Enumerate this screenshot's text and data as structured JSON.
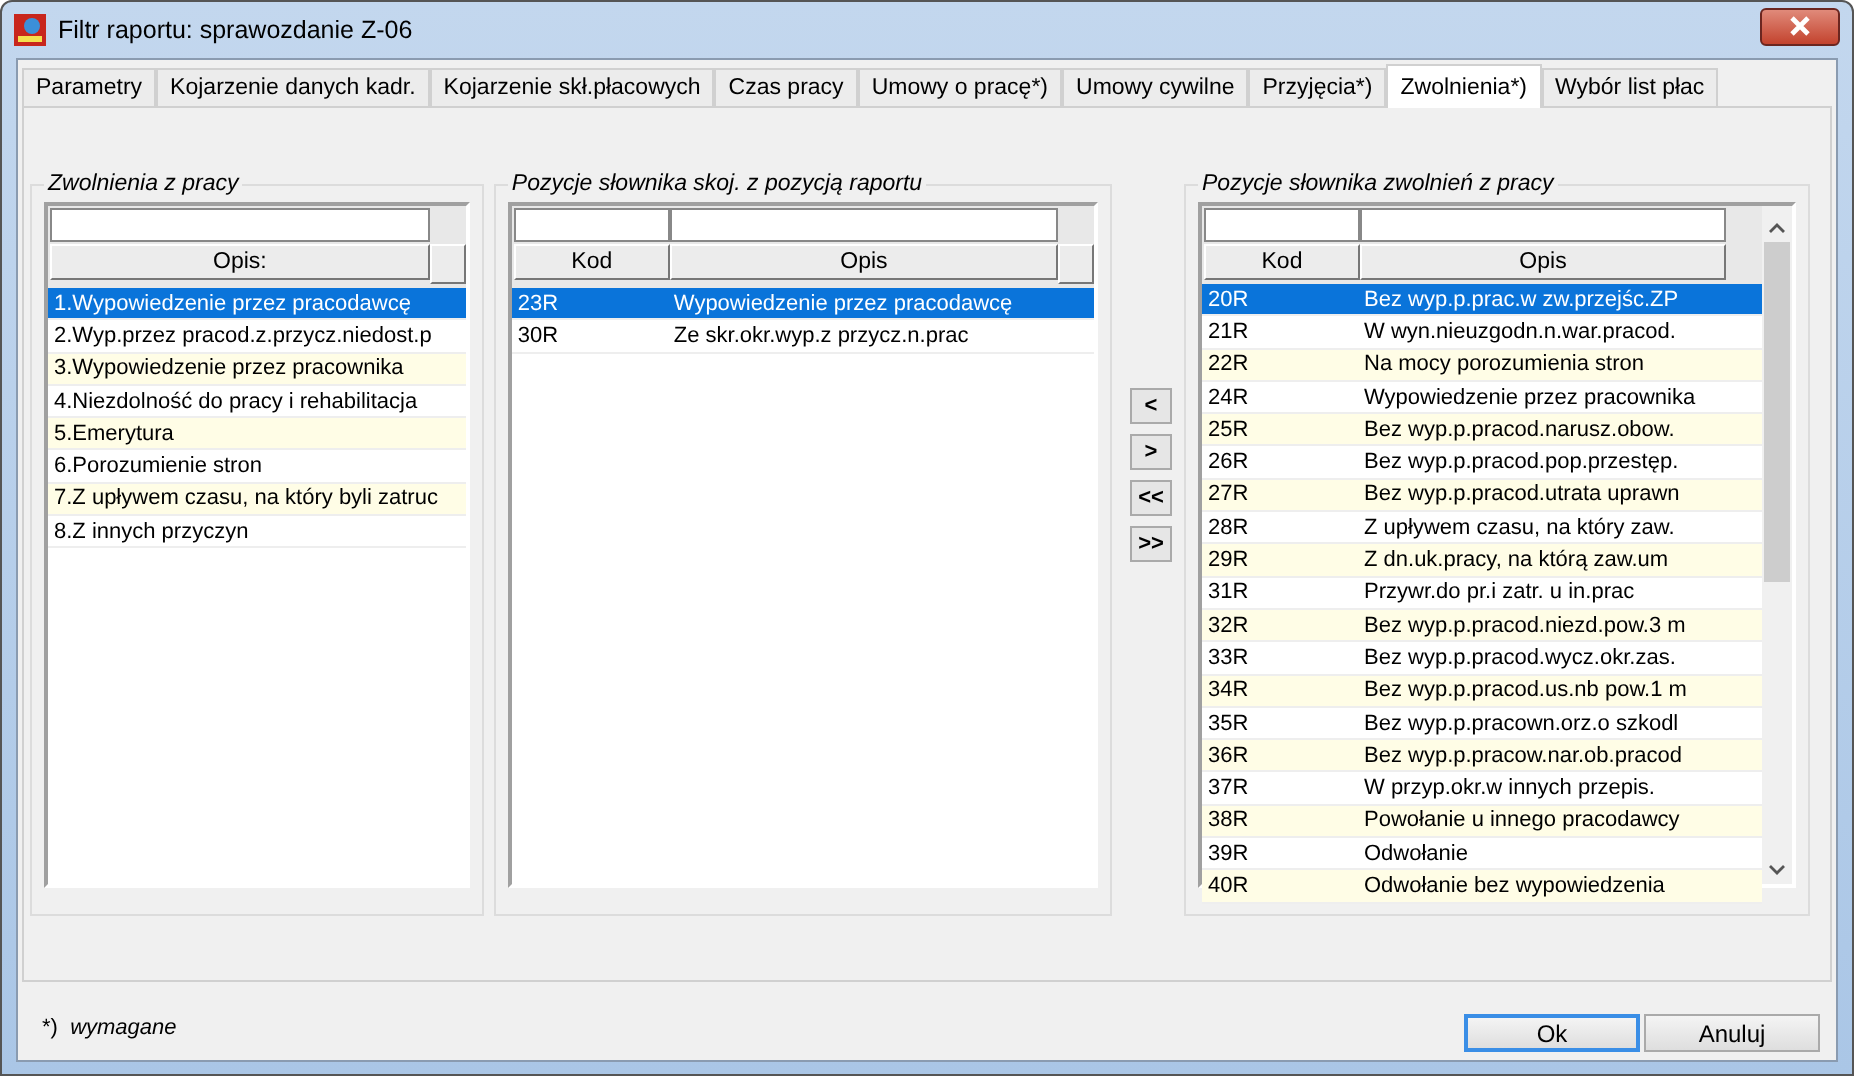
{
  "window": {
    "title": "Filtr raportu: sprawozdanie Z-06"
  },
  "tabs": [
    {
      "label": "Parametry",
      "selected": false
    },
    {
      "label": "Kojarzenie danych kadr.",
      "selected": false
    },
    {
      "label": "Kojarzenie skł.płacowych",
      "selected": false
    },
    {
      "label": "Czas pracy",
      "selected": false
    },
    {
      "label": "Umowy o pracę*)",
      "selected": false
    },
    {
      "label": "Umowy cywilne",
      "selected": false
    },
    {
      "label": "Przyjęcia*)",
      "selected": false
    },
    {
      "label": "Zwolnienia*)",
      "selected": true
    },
    {
      "label": "Wybór list płac",
      "selected": false
    }
  ],
  "groups": [
    {
      "title": "Zwolnienia z pracy",
      "scrollable": false,
      "columns": [
        "Opis:"
      ],
      "rows": [
        {
          "cells": [
            "1.Wypowiedzenie przez pracodawcę"
          ],
          "selected": true
        },
        {
          "cells": [
            "2.Wyp.przez pracod.z.przycz.niedost.p"
          ],
          "selected": false
        },
        {
          "cells": [
            "3.Wypowiedzenie przez pracownika"
          ],
          "selected": false
        },
        {
          "cells": [
            "4.Niezdolność do pracy i rehabilitacja"
          ],
          "selected": false
        },
        {
          "cells": [
            "5.Emerytura"
          ],
          "selected": false
        },
        {
          "cells": [
            "6.Porozumienie stron"
          ],
          "selected": false
        },
        {
          "cells": [
            "7.Z upływem czasu, na który byli zatruc"
          ],
          "selected": false
        },
        {
          "cells": [
            "8.Z innych przyczyn"
          ],
          "selected": false
        }
      ]
    },
    {
      "title": "Pozycje słownika skoj. z pozycją raportu",
      "scrollable": false,
      "columns": [
        "Kod",
        "Opis"
      ],
      "rows": [
        {
          "cells": [
            "23R",
            "Wypowiedzenie przez pracodawcę"
          ],
          "selected": true
        },
        {
          "cells": [
            "30R",
            "Ze skr.okr.wyp.z przycz.n.prac"
          ],
          "selected": false
        }
      ]
    },
    {
      "title": "Pozycje słownika zwolnień z pracy",
      "scrollable": true,
      "columns": [
        "Kod",
        "Opis"
      ],
      "rows": [
        {
          "cells": [
            "20R",
            "Bez wyp.p.prac.w zw.przejśc.ZP"
          ],
          "selected": true
        },
        {
          "cells": [
            "21R",
            "W wyn.nieuzgodn.n.war.pracod."
          ],
          "selected": false
        },
        {
          "cells": [
            "22R",
            "Na mocy porozumienia stron"
          ],
          "selected": false
        },
        {
          "cells": [
            "24R",
            "Wypowiedzenie przez pracownika"
          ],
          "selected": false
        },
        {
          "cells": [
            "25R",
            "Bez wyp.p.pracod.narusz.obow."
          ],
          "selected": false
        },
        {
          "cells": [
            "26R",
            "Bez wyp.p.pracod.pop.przestęp."
          ],
          "selected": false
        },
        {
          "cells": [
            "27R",
            "Bez wyp.p.pracod.utrata uprawn"
          ],
          "selected": false
        },
        {
          "cells": [
            "28R",
            "Z upływem czasu, na który zaw."
          ],
          "selected": false
        },
        {
          "cells": [
            "29R",
            "Z dn.uk.pracy, na którą zaw.um"
          ],
          "selected": false
        },
        {
          "cells": [
            "31R",
            "Przywr.do pr.i zatr. u in.prac"
          ],
          "selected": false
        },
        {
          "cells": [
            "32R",
            "Bez wyp.p.pracod.niezd.pow.3 m"
          ],
          "selected": false
        },
        {
          "cells": [
            "33R",
            "Bez wyp.p.pracod.wycz.okr.zas."
          ],
          "selected": false
        },
        {
          "cells": [
            "34R",
            "Bez wyp.p.pracod.us.nb pow.1 m"
          ],
          "selected": false
        },
        {
          "cells": [
            "35R",
            "Bez wyp.p.pracown.orz.o szkodl"
          ],
          "selected": false
        },
        {
          "cells": [
            "36R",
            "Bez wyp.p.pracow.nar.ob.pracod"
          ],
          "selected": false
        },
        {
          "cells": [
            "37R",
            "W przyp.okr.w innych przepis."
          ],
          "selected": false
        },
        {
          "cells": [
            "38R",
            "Powołanie u innego pracodawcy"
          ],
          "selected": false
        },
        {
          "cells": [
            "39R",
            "Odwołanie"
          ],
          "selected": false
        },
        {
          "cells": [
            "40R",
            "Odwołanie bez wypowiedzenia"
          ],
          "selected": false
        }
      ]
    }
  ],
  "move_buttons": [
    "<",
    ">",
    "<<",
    ">>"
  ],
  "footnote": {
    "mark": "*)",
    "text": "wymagane"
  },
  "buttons": [
    {
      "label": "Ok",
      "default": true
    },
    {
      "label": "Anuluj",
      "default": false
    }
  ]
}
